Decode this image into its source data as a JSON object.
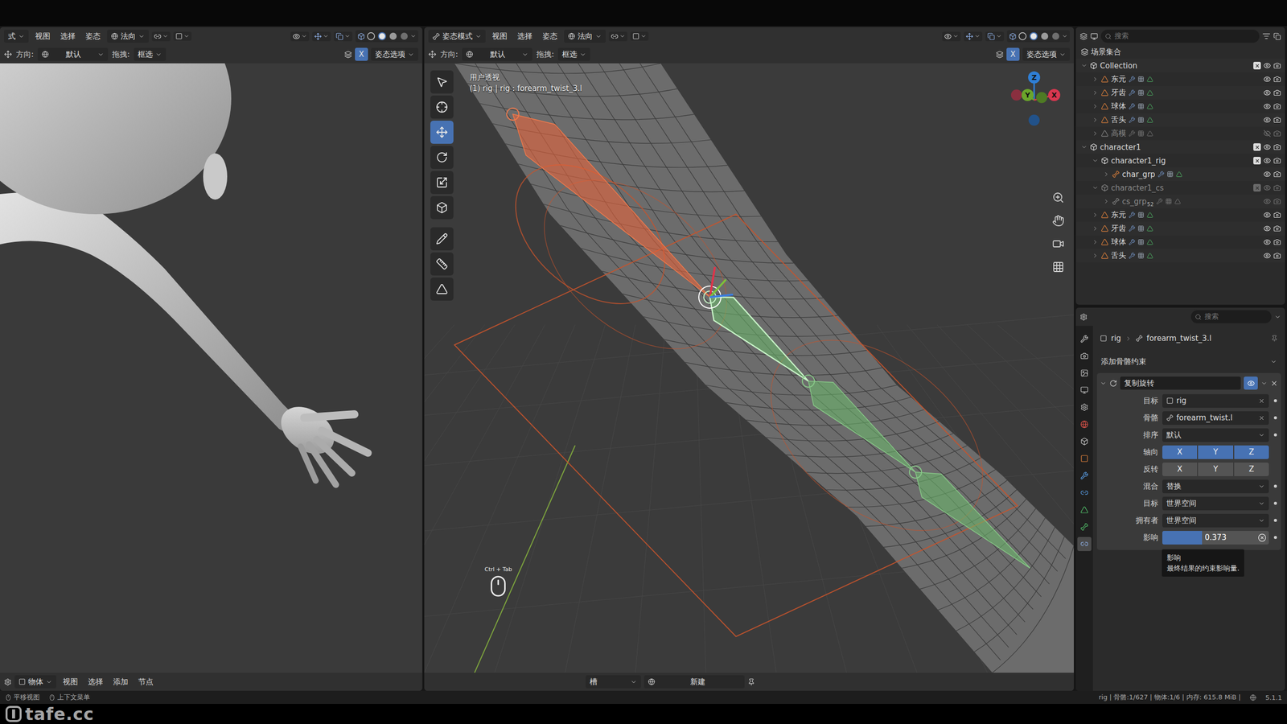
{
  "leftViewport": {
    "header": {
      "mode": "式",
      "menus": [
        "视图",
        "选择",
        "姿态"
      ],
      "orientation": "法向"
    },
    "toolHeader": {
      "directionLabel": "方向:",
      "direction": "默认",
      "dragLabel": "拖拽:",
      "drag": "框选",
      "mirror": "X",
      "mirrorOn": true,
      "options": "姿态选项"
    },
    "footer": {
      "type": "物体",
      "menus": [
        "视图",
        "选择",
        "添加",
        "节点"
      ]
    }
  },
  "mainViewport": {
    "header": {
      "mode": "姿态模式",
      "menus": [
        "视图",
        "选择",
        "姿态"
      ],
      "orientation": "法向"
    },
    "toolHeader": {
      "directionLabel": "方向:",
      "direction": "默认",
      "dragLabel": "拖拽:",
      "drag": "框选",
      "mirror": "X",
      "mirrorOn": true,
      "options": "姿态选项"
    },
    "overlay": {
      "view": "用户透视",
      "info": "(1) rig | rig : forearm_twist_3.l"
    },
    "tools": [
      {
        "kind": "select",
        "selected": false
      },
      {
        "kind": "cursor",
        "selected": false
      },
      {
        "kind": "move",
        "selected": true
      },
      {
        "kind": "rotate",
        "selected": false
      },
      {
        "kind": "scale",
        "selected": false
      },
      {
        "kind": "transform",
        "selected": false
      },
      {
        "kind": "annotate",
        "selected": false
      },
      {
        "kind": "measure",
        "selected": false
      },
      {
        "kind": "curve",
        "selected": false
      }
    ],
    "gizmo": [
      {
        "label": "Z",
        "color": "#2f7fd6"
      },
      {
        "label": "Y",
        "color": "#6aa52b"
      },
      {
        "label": "X",
        "color": "#d8374f"
      }
    ],
    "bones": [
      {
        "kind": "control",
        "selected": false
      },
      {
        "kind": "deform",
        "selected": true
      },
      {
        "kind": "deform",
        "selected": false
      },
      {
        "kind": "deform",
        "selected": false
      }
    ],
    "shortcut": "Ctrl + Tab",
    "footer": {
      "slot": "槽",
      "new": "新建"
    }
  },
  "outliner": {
    "search": "搜索",
    "root": "场景集合",
    "items": [
      {
        "name": "Collection",
        "depth": 0,
        "kind": "collection",
        "expanded": true,
        "muted": false,
        "hidden": false
      },
      {
        "name": "东元",
        "depth": 1,
        "kind": "mesh",
        "expanded": false,
        "muted": false,
        "hidden": false
      },
      {
        "name": "牙齿",
        "depth": 1,
        "kind": "mesh",
        "expanded": false,
        "muted": false,
        "hidden": false
      },
      {
        "name": "球体",
        "depth": 1,
        "kind": "mesh",
        "expanded": false,
        "muted": false,
        "hidden": false
      },
      {
        "name": "舌头",
        "depth": 1,
        "kind": "mesh",
        "expanded": false,
        "muted": false,
        "hidden": false
      },
      {
        "name": "高模",
        "depth": 1,
        "kind": "mesh",
        "expanded": false,
        "muted": true,
        "hidden": true
      },
      {
        "name": "character1",
        "depth": 0,
        "kind": "collection",
        "expanded": true,
        "muted": false,
        "hidden": false
      },
      {
        "name": "character1_rig",
        "depth": 1,
        "kind": "collection",
        "expanded": true,
        "muted": false,
        "hidden": false
      },
      {
        "name": "char_grp",
        "depth": 2,
        "kind": "armature",
        "expanded": false,
        "muted": false,
        "hidden": false
      },
      {
        "name": "character1_cs",
        "depth": 1,
        "kind": "collection",
        "expanded": true,
        "muted": true,
        "hidden": false
      },
      {
        "name": "cs_grp",
        "depth": 2,
        "kind": "armature",
        "expanded": false,
        "muted": true,
        "hidden": false,
        "badge": "52"
      },
      {
        "name": "东元",
        "depth": 1,
        "kind": "mesh",
        "expanded": false,
        "muted": false,
        "hidden": false
      },
      {
        "name": "牙齿",
        "depth": 1,
        "kind": "mesh",
        "expanded": false,
        "muted": false,
        "hidden": false
      },
      {
        "name": "球体",
        "depth": 1,
        "kind": "mesh",
        "expanded": false,
        "muted": false,
        "hidden": false
      },
      {
        "name": "舌头",
        "depth": 1,
        "kind": "mesh",
        "expanded": false,
        "muted": false,
        "hidden": false
      }
    ]
  },
  "properties": {
    "search": "搜索",
    "tabs": [
      {
        "kind": "tool",
        "selected": false
      },
      {
        "kind": "render",
        "selected": false
      },
      {
        "kind": "output",
        "selected": false
      },
      {
        "kind": "view",
        "selected": false
      },
      {
        "kind": "scene",
        "selected": false
      },
      {
        "kind": "world",
        "selected": false
      },
      {
        "kind": "collection",
        "selected": false
      },
      {
        "kind": "object",
        "selected": false
      },
      {
        "kind": "modifier",
        "selected": false
      },
      {
        "kind": "constraint",
        "selected": false
      },
      {
        "kind": "data",
        "selected": false
      },
      {
        "kind": "bone",
        "selected": false
      },
      {
        "kind": "boneconstraint",
        "selected": true
      }
    ],
    "breadcrumb": [
      "rig",
      "forearm_twist_3.l"
    ],
    "addConstraint": "添加骨骼约束",
    "constraint": {
      "name": "复制旋转",
      "enabled": true,
      "expanded": true,
      "rows": [
        {
          "label": "目标",
          "kind": "field",
          "value": "rig"
        },
        {
          "label": "骨骼",
          "kind": "field",
          "value": "forearm_twist.l"
        },
        {
          "label": "排序",
          "kind": "dropdown",
          "value": "默认"
        },
        {
          "label": "轴向",
          "kind": "toggles",
          "options": [
            {
              "label": "X",
              "selected": true
            },
            {
              "label": "Y",
              "selected": true
            },
            {
              "label": "Z",
              "selected": true
            }
          ]
        },
        {
          "label": "反转",
          "kind": "toggles",
          "options": [
            {
              "label": "X",
              "selected": false
            },
            {
              "label": "Y",
              "selected": false
            },
            {
              "label": "Z",
              "selected": false
            }
          ]
        },
        {
          "label": "混合",
          "kind": "dropdown",
          "value": "替换"
        },
        {
          "label": "目标",
          "kind": "dropdown",
          "value": "世界空间"
        },
        {
          "label": "拥有者",
          "kind": "dropdown",
          "value": "世界空间"
        },
        {
          "label": "影响",
          "kind": "slider",
          "value": "0.373",
          "level": 0.373
        }
      ]
    },
    "tooltip": {
      "title": "影响",
      "text": "最终结果的约束影响量."
    }
  },
  "statusBar": {
    "hints": [
      "平移视图",
      "上下文菜单"
    ],
    "info": "rig | 骨骼:1/627 | 物体:1/6 | 内存: 615.8 MiB |",
    "version": "5.1.1"
  },
  "watermark": "tafe.cc"
}
